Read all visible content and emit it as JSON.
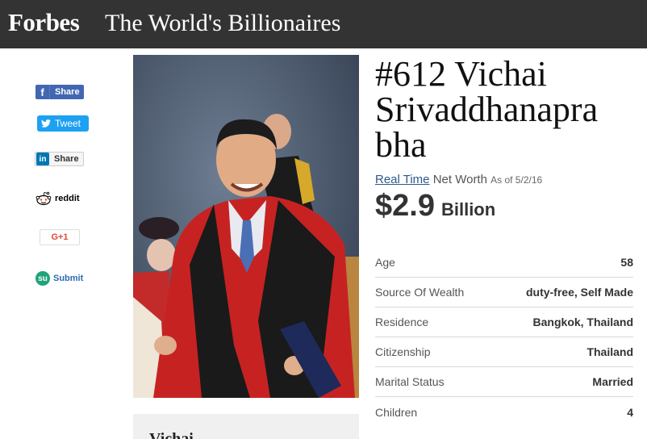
{
  "header": {
    "brand": "Forbes",
    "section_title": "The World's Billionaires"
  },
  "share": {
    "facebook": "Share",
    "twitter": "Tweet",
    "linkedin": "Share",
    "reddit": "reddit",
    "google_plus": "G+1",
    "stumbleupon": "Submit"
  },
  "profile": {
    "rank_name": "#612 Vichai Srivaddhanapra bha",
    "real_time": "Real Time",
    "net_worth_label": "Net Worth",
    "as_of": "As of 5/2/16",
    "net_worth": "$2.9",
    "net_worth_unit": "Billion",
    "bio_name": "Vichai"
  },
  "facts": [
    {
      "label": "Age",
      "value": "58"
    },
    {
      "label": "Source Of Wealth",
      "value": "duty-free, Self Made"
    },
    {
      "label": "Residence",
      "value": "Bangkok, Thailand"
    },
    {
      "label": "Citizenship",
      "value": "Thailand"
    },
    {
      "label": "Marital Status",
      "value": "Married"
    },
    {
      "label": "Children",
      "value": "4"
    }
  ],
  "colors": {
    "header_bg": "#333333",
    "facebook": "#4267b2",
    "twitter": "#1da1f2",
    "linkedin": "#0077b5",
    "link": "#2c5a8a"
  }
}
